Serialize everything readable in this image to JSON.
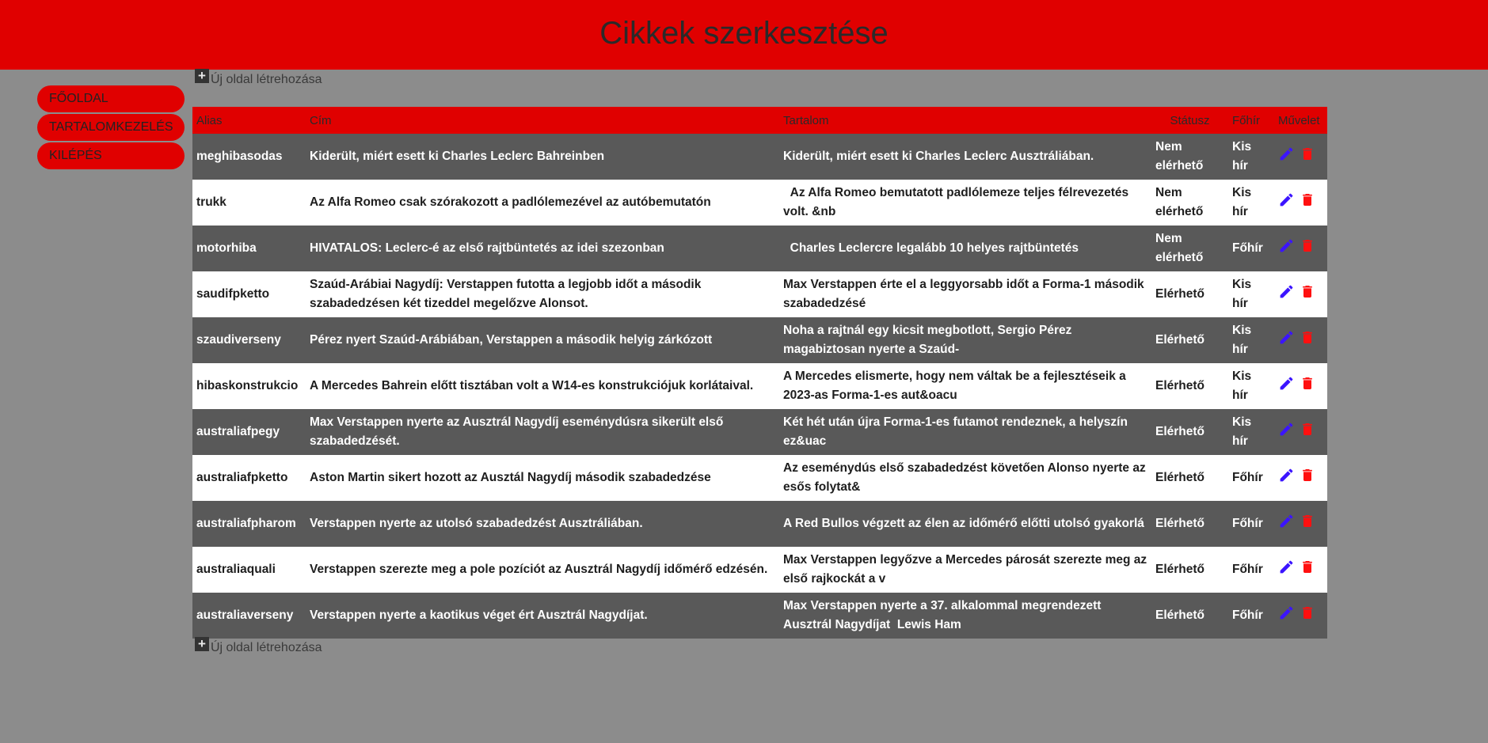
{
  "header": {
    "title": "Cikkek szerkesztése"
  },
  "sidebar": {
    "items": [
      {
        "label": "FŐOLDAL"
      },
      {
        "label": "TARTALOMKEZELÉS"
      },
      {
        "label": "KILÉPÉS"
      }
    ]
  },
  "new_page_link": {
    "label": "Új oldal létrehozása"
  },
  "table": {
    "headers": {
      "alias": "Alias",
      "title": "Cím",
      "content": "Tartalom",
      "status": "Státusz",
      "type": "Főhír",
      "action": "Művelet"
    },
    "rows": [
      {
        "alias": "meghibasodas",
        "title": "Kiderült, miért esett ki Charles Leclerc Bahreinben",
        "content": "Kiderült, miért esett ki Charles Leclerc Ausztráliában.",
        "status": "Nem elérhető",
        "type": "Kis hír"
      },
      {
        "alias": "trukk",
        "title": "Az Alfa Romeo csak szórakozott a padlólemezével az autóbemutatón",
        "content": "  Az Alfa Romeo bemutatott padlólemeze teljes félrevezetés volt. &nb",
        "status": "Nem elérhető",
        "type": "Kis hír"
      },
      {
        "alias": "motorhiba",
        "title": "HIVATALOS: Leclerc-é az első rajtbüntetés az idei szezonban",
        "content": "  Charles Leclercre legalább 10 helyes rajtbüntetés",
        "status": "Nem elérhető",
        "type": "Főhír"
      },
      {
        "alias": "saudifpketto",
        "title": "Szaúd-Arábiai Nagydíj: Verstappen futotta a legjobb időt a második szabadedzésen két tizeddel megelőzve Alonsot.",
        "content": "Max Verstappen érte el a leggyorsabb időt a Forma-1 második szabadedzésé",
        "status": "Elérhető",
        "type": "Kis hír"
      },
      {
        "alias": "szaudiverseny",
        "title": "Pérez nyert Szaúd-Arábiában, Verstappen a második helyig zárkózott",
        "content": "Noha a rajtnál egy kicsit megbotlott, Sergio Pérez magabiztosan nyerte a Szaúd-",
        "status": "Elérhető",
        "type": "Kis hír"
      },
      {
        "alias": "hibaskonstrukcio",
        "title": "A Mercedes Bahrein előtt tisztában volt a W14-es konstrukciójuk korlátaival.",
        "content": "A Mercedes elismerte, hogy nem váltak be a fejlesztéseik a 2023-as Forma-1-es aut&oacu",
        "status": "Elérhető",
        "type": "Kis hír"
      },
      {
        "alias": "australiafpegy",
        "title": "Max Verstappen nyerte az Ausztrál Nagydíj eseménydúsra sikerült első szabadedzését.",
        "content": "Két hét után újra Forma-1-es futamot rendeznek, a helyszín ez&uac",
        "status": "Elérhető",
        "type": "Kis hír"
      },
      {
        "alias": "australiafpketto",
        "title": "Aston Martin sikert hozott az Ausztál Nagydíj második szabadedzése",
        "content": "Az eseménydús első szabadedzést követően Alonso nyerte az esős folytat&",
        "status": "Elérhető",
        "type": "Főhír"
      },
      {
        "alias": "australiafpharom",
        "title": "Verstappen nyerte az utolsó szabadedzést Ausztráliában.",
        "content": "A Red Bullos végzett az élen az időmérő előtti utolsó gyakorlá",
        "status": "Elérhető",
        "type": "Főhír"
      },
      {
        "alias": "australiaquali",
        "title": "Verstappen szerezte meg a pole pozíciót az Ausztrál Nagydíj időmérő edzésén.",
        "content": "Max Verstappen legyőzve a Mercedes párosát szerezte meg az első rajkockát a v",
        "status": "Elérhető",
        "type": "Főhír"
      },
      {
        "alias": "australiaverseny",
        "title": "Verstappen nyerte a kaotikus véget ért Ausztrál Nagydíjat.",
        "content": "Max Verstappen nyerte a 37. alkalommal megrendezett Ausztrál Nagydíjat  Lewis Ham",
        "status": "Elérhető",
        "type": "Főhír"
      }
    ]
  },
  "icons": {
    "edit": "pencil-icon",
    "delete": "trash-icon",
    "add": "plus-icon"
  },
  "colors": {
    "accent": "#e00000",
    "edit_icon": "#3b14ff",
    "delete_icon": "#ff1010",
    "background": "#8c8c8c",
    "row_dark": "#595959"
  }
}
